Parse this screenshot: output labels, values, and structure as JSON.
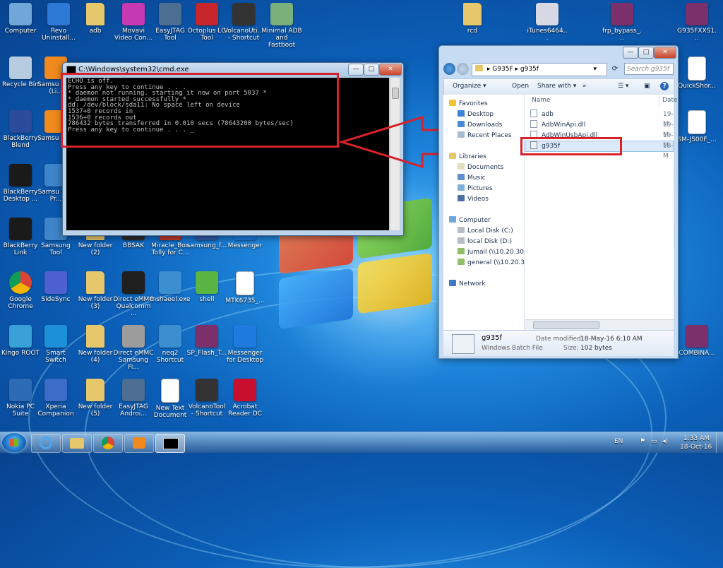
{
  "desktop_icons": [
    {
      "label": "Computer",
      "icon": "computer-icon",
      "color": "#6fa7d8"
    },
    {
      "label": "Revo Uninstall...",
      "icon": "revo-uninstaller-icon",
      "color": "#2d7ad6"
    },
    {
      "label": "adb",
      "icon": "folder-icon",
      "color": "#e7c76c"
    },
    {
      "label": "Movavi Video Con...",
      "icon": "movavi-icon",
      "color": "#c53ab2"
    },
    {
      "label": "EasyJTAG Tool",
      "icon": "easyjtag-icon",
      "color": "#4d6e93"
    },
    {
      "label": "Octoplus LG Tool",
      "icon": "octoplus-icon",
      "color": "#c7262c"
    },
    {
      "label": "VolcanoUti... - Shortcut",
      "icon": "volcano-icon",
      "color": "#333333"
    },
    {
      "label": "Minimal ADB and Fastboot",
      "icon": "minimal-adb-icon",
      "color": "#7ab07a"
    },
    {
      "label": "rcd",
      "icon": "folder-icon",
      "color": "#e7c76c"
    },
    {
      "label": "iTunes6464...",
      "icon": "itunes-setup-icon",
      "color": "#d9d9e6"
    },
    {
      "label": "frp_bypass_...",
      "icon": "winrar-icon",
      "color": "#7b2f6b"
    },
    {
      "label": "G935FXXS1...",
      "icon": "winrar-icon",
      "color": "#7b2f6b"
    },
    {
      "label": "Recycle Bin",
      "icon": "recycle-bin-icon",
      "color": "#b7cbe0"
    },
    {
      "label": "QuickShor...",
      "icon": "document-icon",
      "color": "#ffffff"
    },
    {
      "label": "BlackBerry Blend",
      "icon": "blackberry-blend-icon",
      "color": "#2a4c9a"
    },
    {
      "label": "SM-J500F_...",
      "icon": "document-icon",
      "color": "#ffffff"
    },
    {
      "label": "BlackBerry Desktop ...",
      "icon": "blackberry-icon",
      "color": "#1a1a1a"
    },
    {
      "label": "BlackBerry Link",
      "icon": "blackberry-link-icon",
      "color": "#1a1a1a"
    },
    {
      "label": "Samsung Tool",
      "icon": "samsung-tool-icon",
      "color": "#3d84c8"
    },
    {
      "label": "New folder (2)",
      "icon": "folder-icon",
      "color": "#e7c76c"
    },
    {
      "label": "BBSAK",
      "icon": "bbsak-icon",
      "color": "#2c2c2c"
    },
    {
      "label": "Miracle_Box Tolly for C...",
      "icon": "miracle-box-icon",
      "color": "#c23a2a"
    },
    {
      "label": "samsung_f...",
      "icon": "samsung-icon",
      "color": "#315ca8"
    },
    {
      "label": "Messenger",
      "icon": "messenger-icon",
      "color": "#1f7ae0"
    },
    {
      "label": "Google Chrome",
      "icon": "chrome-icon",
      "color": "#e1ad1e"
    },
    {
      "label": "SideSync",
      "icon": "sidesync-icon",
      "color": "#4e5fd1"
    },
    {
      "label": "New folder (3)",
      "icon": "folder-icon",
      "color": "#e7c76c"
    },
    {
      "label": "Direct eMMC Qualcomm ...",
      "icon": "emmc-icon",
      "color": "#1f1f1f"
    },
    {
      "label": "mshaeel.exe",
      "icon": "globe-icon",
      "color": "#3b8fd0"
    },
    {
      "label": "shell",
      "icon": "shell-icon",
      "color": "#5bb543"
    },
    {
      "label": "MTK6735_...",
      "icon": "document-icon",
      "color": "#ffffff"
    },
    {
      "label": "Kingo ROOT",
      "icon": "kingo-root-icon",
      "color": "#3aa0d8"
    },
    {
      "label": "Smart Switch",
      "icon": "smart-switch-icon",
      "color": "#1c90d8"
    },
    {
      "label": "New folder (4)",
      "icon": "folder-icon",
      "color": "#e7c76c"
    },
    {
      "label": "Direct eMMC Samsung Fi...",
      "icon": "emmc-samsung-icon",
      "color": "#9c9c9c"
    },
    {
      "label": "neq2 Shortcut",
      "icon": "globe-icon",
      "color": "#3b8fd0"
    },
    {
      "label": "SP_Flash_T...",
      "icon": "winrar-icon",
      "color": "#7b2f6b"
    },
    {
      "label": "Messenger for Desktop",
      "icon": "messenger-icon",
      "color": "#1f7ae0"
    },
    {
      "label": "COMBINA...",
      "icon": "winrar-icon",
      "color": "#7b2f6b"
    },
    {
      "label": "Nokia PC Suite",
      "icon": "nokia-pc-suite-icon",
      "color": "#2e6bb6"
    },
    {
      "label": "Xperia Companion",
      "icon": "xperia-icon",
      "color": "#3a6cc8"
    },
    {
      "label": "New folder (5)",
      "icon": "folder-icon",
      "color": "#e7c76c"
    },
    {
      "label": "EasyJTAG Androi...",
      "icon": "easyjtag-android-icon",
      "color": "#4d6e93"
    },
    {
      "label": "New Text Document",
      "icon": "text-document-icon",
      "color": "#ffffff"
    },
    {
      "label": "VolcanoTool - Shortcut",
      "icon": "volcano-icon",
      "color": "#333333"
    },
    {
      "label": "Acrobat Reader DC",
      "icon": "acrobat-icon",
      "color": "#c8102e"
    },
    {
      "label": "Samsu Kies (Li...",
      "icon": "samsung-kies-icon",
      "color": "#f08a1e"
    },
    {
      "label": "Samsu Kies",
      "icon": "samsung-kies-icon",
      "color": "#f08a1e"
    },
    {
      "label": "Samsu Tool Pr...",
      "icon": "samsung-tool-icon",
      "color": "#3d84c8"
    }
  ],
  "cmd": {
    "title": "C:\\Windows\\system32\\cmd.exe",
    "output": "ECHO is off.\nPress any key to continue . . .\n* daemon not running. starting it now on port 5037 *\n* daemon started successfully *\ndd: /dev/block/sda11: No space left on device\n1537+0 records in\n1536+0 records out\n786432 bytes transferred in 0.010 secs (78643200 bytes/sec)\nPress any key to continue . . . _",
    "minimize_label": "—",
    "maximize_label": "□",
    "close_label": "✕"
  },
  "explorer": {
    "breadcrumb": [
      "G935F",
      "g935f"
    ],
    "search_placeholder": "Search g935f",
    "toolbar": {
      "organize": "Organize ▾",
      "open": "Open",
      "share_with": "Share with ▾"
    },
    "nav": {
      "favorites_header": "Favorites",
      "favorites": [
        "Desktop",
        "Downloads",
        "Recent Places"
      ],
      "libraries_header": "Libraries",
      "libraries": [
        "Documents",
        "Music",
        "Pictures",
        "Videos"
      ],
      "computer_header": "Computer",
      "computer": [
        "Local Disk (C:)",
        "local Disk  (D:)",
        "jumail (\\\\10.20.30.80",
        "general (\\\\10.20.30.8"
      ],
      "network": "Network"
    },
    "columns": {
      "name": "Name",
      "date": "Date"
    },
    "files": [
      {
        "name": "adb",
        "date": "19-M"
      },
      {
        "name": "AdbWinApi.dll",
        "date": "19-M"
      },
      {
        "name": "AdbWinUsbApi.dll",
        "date": "19-M"
      },
      {
        "name": "g935f",
        "date": "18-M"
      }
    ],
    "details": {
      "name": "g935f",
      "type": "Windows Batch File",
      "date_modified_label": "Date modified:",
      "date_modified": "18-May-16 6:10 AM",
      "size_label": "Size:",
      "size": "102 bytes"
    }
  },
  "taskbar": {
    "language": "EN",
    "time": "1:33 AM",
    "date": "18-Oct-16"
  },
  "colors": {
    "highlight": "#d7222a",
    "accent": "#1e86dc"
  }
}
